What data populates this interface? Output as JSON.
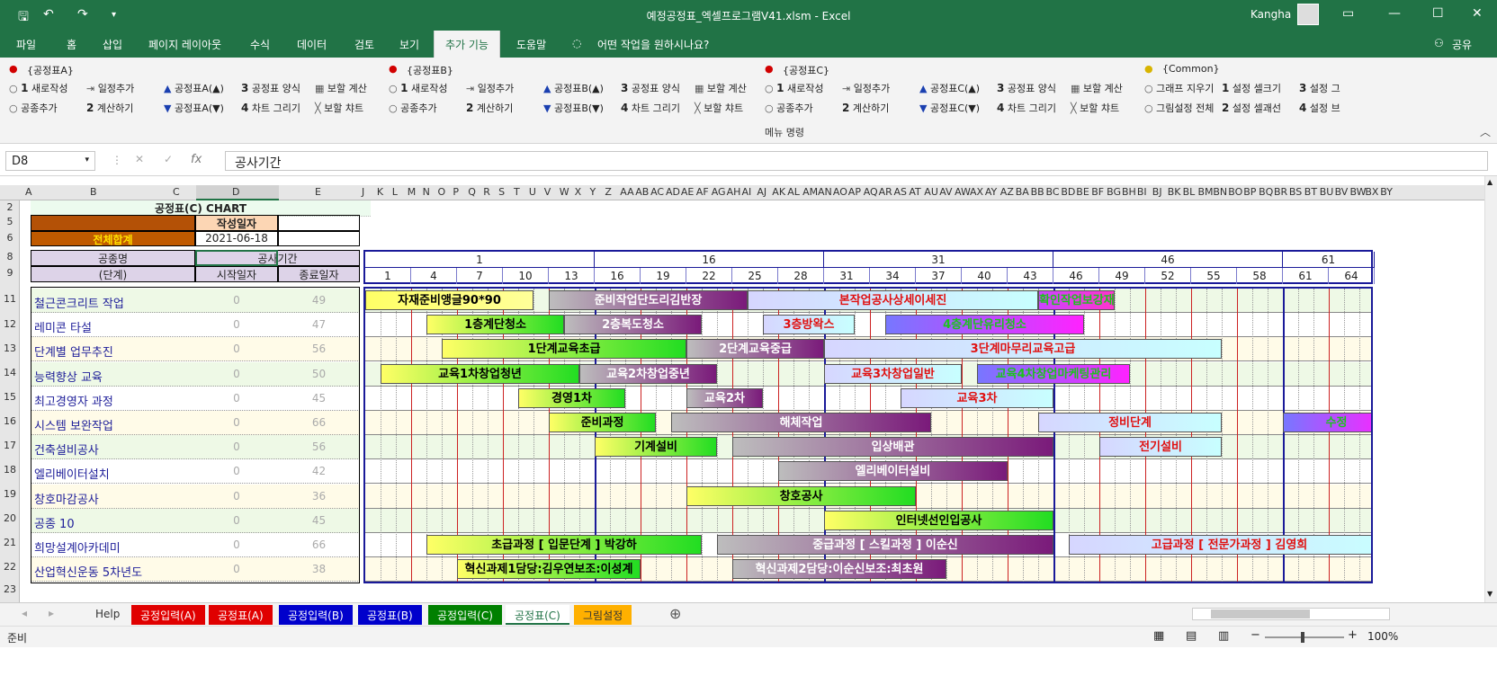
{
  "window": {
    "title": "예정공정표_엑셀프로그램V41.xlsm  -  Excel",
    "user": "Kangha"
  },
  "ribbon_tabs": [
    "파일",
    "홈",
    "삽입",
    "페이지 레이아웃",
    "수식",
    "데이터",
    "검토",
    "보기",
    "추가 기능",
    "도움말",
    "어떤 작업을 원하시나요?"
  ],
  "active_tab": "추가 기능",
  "share_label": "공유",
  "groups": [
    {
      "title": "{공정표A}",
      "items": [
        [
          "○",
          "1",
          "새로작성"
        ],
        [
          "⇥",
          "",
          "일정추가"
        ],
        [
          "▲",
          "",
          "공정표A(▲)"
        ],
        [
          "",
          "3",
          "공정표 양식"
        ],
        [
          "▦",
          "",
          "보할 계산"
        ],
        [
          "○",
          "",
          "공종추가"
        ],
        [
          "",
          "2",
          "계산하기"
        ],
        [
          "▼",
          "",
          "공정표A(▼)"
        ],
        [
          "",
          "4",
          "차트 그리기"
        ],
        [
          "╳",
          "",
          "보할 챠트"
        ]
      ]
    },
    {
      "title": "{공정표B}",
      "items": [
        [
          "○",
          "1",
          "새로작성"
        ],
        [
          "⇥",
          "",
          "일정추가"
        ],
        [
          "▲",
          "",
          "공정표B(▲)"
        ],
        [
          "",
          "3",
          "공정표 양식"
        ],
        [
          "▦",
          "",
          "보할 계산"
        ],
        [
          "○",
          "",
          "공종추가"
        ],
        [
          "",
          "2",
          "계산하기"
        ],
        [
          "▼",
          "",
          "공정표B(▼)"
        ],
        [
          "",
          "4",
          "차트 그리기"
        ],
        [
          "╳",
          "",
          "보할 챠트"
        ]
      ]
    },
    {
      "title": "{공정표C}",
      "items": [
        [
          "○",
          "1",
          "새로작성"
        ],
        [
          "⇥",
          "",
          "일정추가"
        ],
        [
          "▲",
          "",
          "공정표C(▲)"
        ],
        [
          "",
          "3",
          "공정표 양식"
        ],
        [
          "▦",
          "",
          "보할 계산"
        ],
        [
          "○",
          "",
          "공종추가"
        ],
        [
          "",
          "2",
          "계산하기"
        ],
        [
          "▼",
          "",
          "공정표C(▼)"
        ],
        [
          "",
          "4",
          "차트 그리기"
        ],
        [
          "╳",
          "",
          "보할 챠트"
        ]
      ]
    },
    {
      "title": "{Common}",
      "items": [
        [
          "○",
          "",
          "그래프 지우기"
        ],
        [
          "",
          "1",
          "설정 셀크기"
        ],
        [
          "",
          "3",
          "설정 그"
        ],
        [
          "",
          "",
          ""
        ],
        [
          "",
          "",
          ""
        ],
        [
          "○",
          "",
          "그림설정 전체"
        ],
        [
          "",
          "2",
          "설정 셀괘선"
        ],
        [
          "",
          "4",
          "설정 브"
        ],
        [
          "",
          "",
          ""
        ],
        [
          "",
          "",
          ""
        ]
      ]
    }
  ],
  "ribbon_caption": "메뉴 명령",
  "formula": {
    "namebox": "D8",
    "fx": "fx",
    "value": "공사기간"
  },
  "col_letters": "A B C D E J K L M N O P Q R S T U V W X Y Z AA AB AC AD AE AF AG AH AI AJ AK AL AM AN AO AP AQ AR AS AT AU AV AW AX AY AZ BA BB BC BD BE BF BG BH BI BJ BK BL BM BN BO BP BQ BR BS BT BU BV BW BX BY",
  "row_numbers": [
    "2",
    "5",
    "6",
    "8",
    "9",
    "11",
    "12",
    "13",
    "14",
    "15",
    "16",
    "17",
    "18",
    "19",
    "20",
    "21",
    "22",
    "23"
  ],
  "sheet": {
    "chart_title": "공정표(C) CHART",
    "date_label": "작성일자",
    "total_label": "전체합계",
    "date_value": "2021-06-18",
    "hdr_kind": "공종명",
    "hdr_kind2": "(단계)",
    "hdr_period": "공사기간",
    "hdr_start": "시작일자",
    "hdr_end": "종료일자",
    "scale_major": [
      "1",
      "16",
      "31",
      "46",
      "61"
    ],
    "scale_minor": [
      "1",
      "4",
      "7",
      "10",
      "13",
      "16",
      "19",
      "22",
      "25",
      "28",
      "31",
      "34",
      "37",
      "40",
      "43",
      "46",
      "49",
      "52",
      "55",
      "58",
      "61",
      "64"
    ]
  },
  "tasks": [
    {
      "name": "철근콘크리트 작업",
      "start": "0",
      "end": "49"
    },
    {
      "name": "레미콘 타설",
      "start": "0",
      "end": "47"
    },
    {
      "name": "단계별 업무추진",
      "start": "0",
      "end": "56"
    },
    {
      "name": "능력향상 교육",
      "start": "0",
      "end": "50"
    },
    {
      "name": "최고경영자 과정",
      "start": "0",
      "end": "45"
    },
    {
      "name": "시스템 보완작업",
      "start": "0",
      "end": "66"
    },
    {
      "name": "건축설비공사",
      "start": "0",
      "end": "56"
    },
    {
      "name": "엘리베이터설치",
      "start": "0",
      "end": "42"
    },
    {
      "name": "창호마감공사",
      "start": "0",
      "end": "36"
    },
    {
      "name": "공종 10",
      "start": "0",
      "end": "45"
    },
    {
      "name": "희망설계아카데미",
      "start": "0",
      "end": "66"
    },
    {
      "name": "산업혁신운동 5차년도",
      "start": "0",
      "end": "38"
    }
  ],
  "bars": [
    {
      "row": 0,
      "s": 1,
      "e": 12,
      "label": "자재준비앵글90*90",
      "style": "y"
    },
    {
      "row": 0,
      "s": 13,
      "e": 26,
      "label": "준비작업단도리김반장",
      "style": "gp"
    },
    {
      "row": 0,
      "s": 26,
      "e": 45,
      "label": "본작업공사상세이세진",
      "style": "lc"
    },
    {
      "row": 0,
      "s": 45,
      "e": 50,
      "label": "확인작업보강재검토",
      "style": "m"
    },
    {
      "row": 1,
      "s": 5,
      "e": 14,
      "label": "1층계단청소",
      "style": "yg"
    },
    {
      "row": 1,
      "s": 14,
      "e": 23,
      "label": "2층복도청소",
      "style": "gp"
    },
    {
      "row": 1,
      "s": 27,
      "e": 33,
      "label": "3층방왁스",
      "style": "lc"
    },
    {
      "row": 1,
      "s": 35,
      "e": 48,
      "label": "4층계단유리청소",
      "style": "bm"
    },
    {
      "row": 2,
      "s": 6,
      "e": 22,
      "label": "1단계교육초급",
      "style": "yg"
    },
    {
      "row": 2,
      "s": 22,
      "e": 31,
      "label": "2단계교육중급",
      "style": "gp"
    },
    {
      "row": 2,
      "s": 31,
      "e": 57,
      "label": "3단계마무리교육고급",
      "style": "lc"
    },
    {
      "row": 3,
      "s": 2,
      "e": 15,
      "label": "교육1차창업청년",
      "style": "yg"
    },
    {
      "row": 3,
      "s": 15,
      "e": 24,
      "label": "교육2차창업중년",
      "style": "gp"
    },
    {
      "row": 3,
      "s": 31,
      "e": 40,
      "label": "교육3차창업일반",
      "style": "lc"
    },
    {
      "row": 3,
      "s": 41,
      "e": 51,
      "label": "교육4차창업마케팅관리",
      "style": "bm"
    },
    {
      "row": 4,
      "s": 11,
      "e": 18,
      "label": "경영1차",
      "style": "yg"
    },
    {
      "row": 4,
      "s": 22,
      "e": 27,
      "label": "교육2차",
      "style": "gp"
    },
    {
      "row": 4,
      "s": 36,
      "e": 46,
      "label": "교육3차",
      "style": "lc"
    },
    {
      "row": 5,
      "s": 13,
      "e": 20,
      "label": "준비과정",
      "style": "yg"
    },
    {
      "row": 5,
      "s": 21,
      "e": 38,
      "label": "해체작업",
      "style": "gp"
    },
    {
      "row": 5,
      "s": 45,
      "e": 57,
      "label": "정비단계",
      "style": "lc"
    },
    {
      "row": 5,
      "s": 61,
      "e": 68,
      "label": "수정",
      "style": "bm"
    },
    {
      "row": 6,
      "s": 16,
      "e": 24,
      "label": "기계설비",
      "style": "yg"
    },
    {
      "row": 6,
      "s": 25,
      "e": 46,
      "label": "입상배관",
      "style": "gp"
    },
    {
      "row": 6,
      "s": 49,
      "e": 57,
      "label": "전기설비",
      "style": "lc"
    },
    {
      "row": 7,
      "s": 28,
      "e": 43,
      "label": "엘리베이터설비",
      "style": "gp"
    },
    {
      "row": 8,
      "s": 22,
      "e": 37,
      "label": "창호공사",
      "style": "yg"
    },
    {
      "row": 9,
      "s": 31,
      "e": 46,
      "label": "인터넷선인입공사",
      "style": "yg"
    },
    {
      "row": 10,
      "s": 5,
      "e": 23,
      "label": "초급과정 [ 입문단계 ] 박강하",
      "style": "yg"
    },
    {
      "row": 10,
      "s": 24,
      "e": 46,
      "label": "중급과정 [ 스킬과정 ] 이순신",
      "style": "gp"
    },
    {
      "row": 10,
      "s": 47,
      "e": 68,
      "label": "고급과정 [ 전문가과정 ] 김영희",
      "style": "lc"
    },
    {
      "row": 11,
      "s": 7,
      "e": 19,
      "label": "혁신과제1담당:김우연보조:이성계",
      "style": "yg"
    },
    {
      "row": 11,
      "s": 25,
      "e": 39,
      "label": "혁신과제2담당:이순신보조:최초원",
      "style": "gp"
    }
  ],
  "sheet_tabs": [
    {
      "label": "Help",
      "color": "#f3f3f3",
      "fg": "#333"
    },
    {
      "label": "공정입력(A)",
      "color": "#e00000",
      "fg": "#fff"
    },
    {
      "label": "공정표(A)",
      "color": "#e00000",
      "fg": "#fff"
    },
    {
      "label": "공정입력(B)",
      "color": "#0000cc",
      "fg": "#fff"
    },
    {
      "label": "공정표(B)",
      "color": "#0000cc",
      "fg": "#fff"
    },
    {
      "label": "공정입력(C)",
      "color": "#008000",
      "fg": "#fff"
    },
    {
      "label": "공정표(C)",
      "color": "#ffffff",
      "fg": "#217346"
    },
    {
      "label": "그림설정",
      "color": "#ffb000",
      "fg": "#333"
    }
  ],
  "status": {
    "ready": "준비",
    "zoom": "100%"
  },
  "colors": {
    "excel_green": "#217346",
    "header_brown": "#c05a00",
    "task_blue": "#1e1e99",
    "grid_red": "#cc2222",
    "grid_blue": "#1a1a99"
  }
}
